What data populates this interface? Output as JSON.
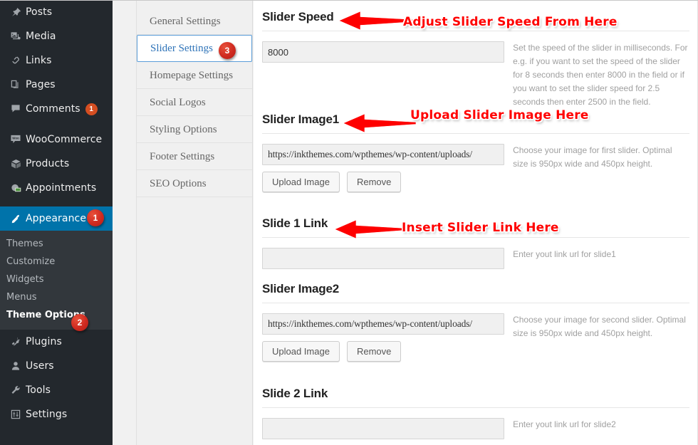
{
  "admin_menu": {
    "items": [
      {
        "label": "Posts",
        "icon": "pin-icon",
        "badge": null
      },
      {
        "label": "Media",
        "icon": "media-icon",
        "badge": null
      },
      {
        "label": "Links",
        "icon": "link-icon",
        "badge": null
      },
      {
        "label": "Pages",
        "icon": "pages-icon",
        "badge": null
      },
      {
        "label": "Comments",
        "icon": "comment-icon",
        "badge": "1"
      },
      {
        "label": "WooCommerce",
        "icon": "woocommerce-icon",
        "badge": null
      },
      {
        "label": "Products",
        "icon": "products-icon",
        "badge": null
      },
      {
        "label": "Appointments",
        "icon": "appointments-icon",
        "badge": null
      },
      {
        "label": "Appearance",
        "icon": "appearance-icon",
        "badge": null
      },
      {
        "label": "Plugins",
        "icon": "plugins-icon",
        "badge": null
      },
      {
        "label": "Users",
        "icon": "users-icon",
        "badge": null
      },
      {
        "label": "Tools",
        "icon": "tools-icon",
        "badge": null
      },
      {
        "label": "Settings",
        "icon": "settings-icon",
        "badge": null
      }
    ],
    "submenu": [
      {
        "label": "Themes"
      },
      {
        "label": "Customize"
      },
      {
        "label": "Widgets"
      },
      {
        "label": "Menus"
      },
      {
        "label": "Theme Options"
      }
    ],
    "step_badges": {
      "appearance": "1",
      "theme_options": "2",
      "slider_settings": "3"
    }
  },
  "tabs": [
    {
      "label": "General Settings"
    },
    {
      "label": "Slider Settings"
    },
    {
      "label": "Homepage Settings"
    },
    {
      "label": "Social Logos"
    },
    {
      "label": "Styling Options"
    },
    {
      "label": "Footer Settings"
    },
    {
      "label": "SEO Options"
    }
  ],
  "fields": [
    {
      "title": "Slider Speed",
      "value": "8000",
      "placeholder": "",
      "help": "Set the speed of the slider in milliseconds. For e.g. if you want to set the speed of the slider for 8 seconds then enter 8000 in the field or if you want to set the slider speed for 2.5 seconds then enter 2500 in the field.",
      "upload_label": "Upload Image",
      "remove_label": "Remove"
    },
    {
      "title": "Slider Image1",
      "value": "https://inkthemes.com/wpthemes/wp-content/uploads/",
      "placeholder": "",
      "help": "Choose your image for first slider. Optimal size is 950px wide and 450px height.",
      "upload_label": "Upload Image",
      "remove_label": "Remove"
    },
    {
      "title": "Slide 1 Link",
      "value": "",
      "placeholder": "",
      "help": "Enter yout link url for slide1",
      "upload_label": "Upload Image",
      "remove_label": "Remove"
    },
    {
      "title": "Slider Image2",
      "value": "https://inkthemes.com/wpthemes/wp-content/uploads/",
      "placeholder": "",
      "help": "Choose your image for second slider. Optimal size is 950px wide and 450px height.",
      "upload_label": "Upload Image",
      "remove_label": "Remove"
    },
    {
      "title": "Slide 2 Link",
      "value": "",
      "placeholder": "",
      "help": "Enter yout link url for slide2",
      "upload_label": "Upload Image",
      "remove_label": "Remove"
    }
  ],
  "annotations": [
    {
      "text": "Adjust Slider Speed From Here"
    },
    {
      "text": "Upload Slider Image Here"
    },
    {
      "text": "Insert Slider Link Here"
    }
  ],
  "colors": {
    "menu_bg": "#23282d",
    "submenu_bg": "#32373c",
    "current_menu": "#0073aa",
    "badge_red": "#cf2a20",
    "count_orange": "#d54e21",
    "annotation_red": "#ff0000",
    "active_tab_text": "#2e73b8",
    "active_tab_border": "#5b9dd9"
  }
}
